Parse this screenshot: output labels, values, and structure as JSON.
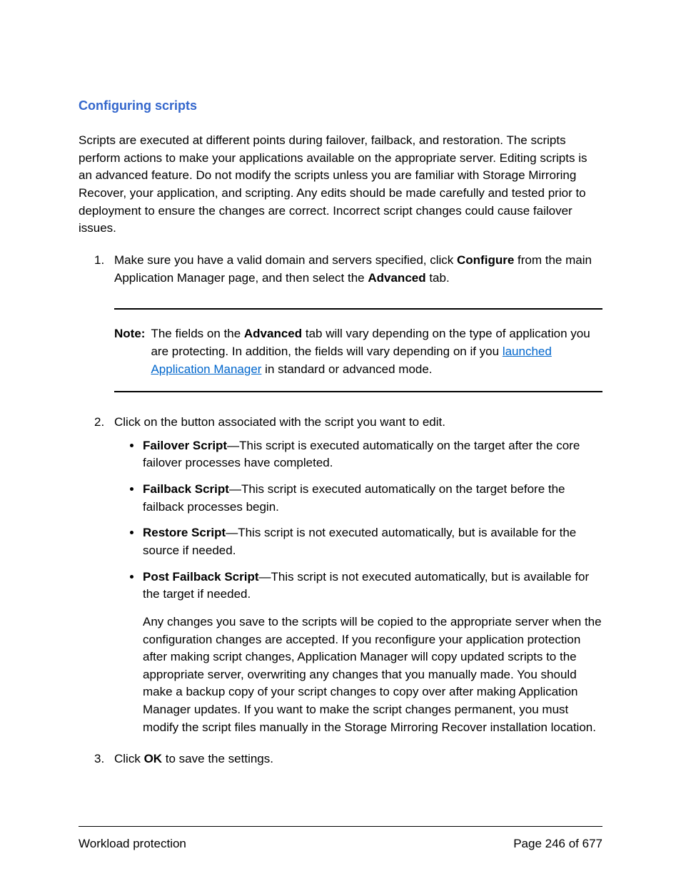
{
  "heading": "Configuring scripts",
  "intro": "Scripts are executed at different points during failover, failback, and restoration. The scripts perform actions to make your applications available on the appropriate server. Editing scripts is an advanced feature. Do not modify the scripts unless you are familiar with Storage Mirroring Recover, your application, and scripting. Any edits should be made carefully and tested prior to deployment to ensure the changes are correct. Incorrect script changes could cause failover issues.",
  "step1_part1": "Make sure you have a valid domain and servers specified, click ",
  "step1_bold1": "Configure",
  "step1_part2": " from the main Application Manager page, and then select the ",
  "step1_bold2": "Advanced",
  "step1_part3": " tab.",
  "note_label": "Note:",
  "note_part1": "The fields on the ",
  "note_bold1": "Advanced",
  "note_part2": " tab will vary depending on the type of application you are protecting. In addition, the fields will vary depending on if you ",
  "note_link": "launched Application Manager",
  "note_part3": " in standard or advanced mode.",
  "step2_intro": "Click on the button associated with the script you want to edit.",
  "bullet1_bold": "Failover Script",
  "bullet1_text": "—This script is executed automatically on the target after the core failover processes have completed.",
  "bullet2_bold": "Failback Script",
  "bullet2_text": "—This script is executed automatically on the target before the failback processes begin.",
  "bullet3_bold": "Restore Script",
  "bullet3_text": "—This script is not executed automatically, but is available for the source if needed.",
  "bullet4_bold": "Post Failback Script",
  "bullet4_text": "—This script is not executed automatically, but is available for the target if needed.",
  "step2_followup": "Any changes you save to the scripts will be copied to the appropriate server when the configuration changes are accepted. If you reconfigure your application protection after making script changes, Application Manager will copy updated scripts to the appropriate server, overwriting any changes that you manually made. You should make a backup copy of your script changes to copy over after making Application Manager updates. If you want to make the script changes permanent, you must modify the script files manually in the Storage Mirroring Recover installation location.",
  "step3_part1": "Click ",
  "step3_bold": "OK",
  "step3_part2": " to save the settings.",
  "footer_left": "Workload protection",
  "footer_right": "Page 246 of 677"
}
